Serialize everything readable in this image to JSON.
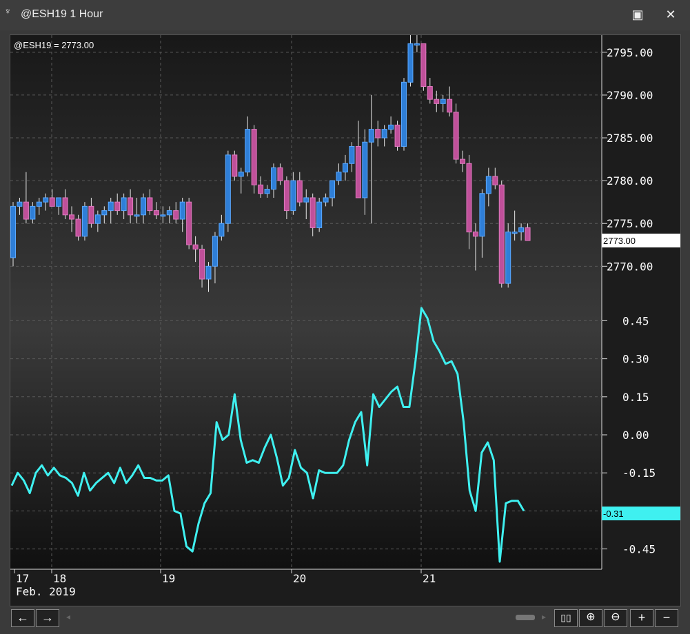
{
  "window": {
    "title": "@ESH19 1 Hour",
    "maximize_icon": "maximize-icon",
    "close_icon": "close-icon"
  },
  "chart_data": [
    {
      "type": "candlestick",
      "title": "@ESH19 = 2773.00",
      "ylim": [
        2766,
        2797
      ],
      "yticks": [
        "2795.00",
        "2790.00",
        "2785.00",
        "2780.00",
        "2775.00",
        "2770.00"
      ],
      "last_price_label": "2773.00",
      "x_labels": [
        "17",
        "18",
        "19",
        "20",
        "21"
      ],
      "x_sublabel": "Feb. 2019",
      "colors": {
        "up": "#2f7fd8",
        "down": "#c0509a",
        "wick": "#e8e8e8"
      },
      "candles": [
        [
          2771.0,
          2777.5,
          2770.0,
          2777.0
        ],
        [
          2777.0,
          2778.0,
          2776.0,
          2777.5
        ],
        [
          2777.5,
          2781.0,
          2775.0,
          2775.5
        ],
        [
          2775.5,
          2777.5,
          2775.0,
          2777.0
        ],
        [
          2777.0,
          2778.0,
          2776.0,
          2777.5
        ],
        [
          2777.5,
          2778.5,
          2776.5,
          2778.0
        ],
        [
          2778.0,
          2779.0,
          2777.0,
          2777.0
        ],
        [
          2777.0,
          2778.0,
          2776.0,
          2778.0
        ],
        [
          2778.0,
          2779.0,
          2775.5,
          2776.0
        ],
        [
          2776.0,
          2777.0,
          2774.0,
          2775.5
        ],
        [
          2775.5,
          2776.0,
          2773.0,
          2773.5
        ],
        [
          2773.5,
          2777.5,
          2773.0,
          2777.0
        ],
        [
          2777.0,
          2778.0,
          2774.5,
          2775.0
        ],
        [
          2775.0,
          2776.5,
          2774.0,
          2776.0
        ],
        [
          2776.0,
          2777.0,
          2775.0,
          2776.5
        ],
        [
          2776.5,
          2778.0,
          2775.0,
          2777.5
        ],
        [
          2777.5,
          2778.5,
          2776.0,
          2776.5
        ],
        [
          2776.5,
          2778.5,
          2775.5,
          2778.0
        ],
        [
          2778.0,
          2779.0,
          2775.0,
          2776.0
        ],
        [
          2776.0,
          2778.0,
          2775.0,
          2776.0
        ],
        [
          2776.0,
          2778.5,
          2775.0,
          2778.0
        ],
        [
          2778.0,
          2779.0,
          2776.0,
          2776.5
        ],
        [
          2776.5,
          2777.5,
          2775.5,
          2776.0
        ],
        [
          2776.0,
          2777.0,
          2775.0,
          2776.0
        ],
        [
          2776.0,
          2777.0,
          2775.0,
          2776.5
        ],
        [
          2776.5,
          2777.5,
          2775.0,
          2775.5
        ],
        [
          2775.5,
          2778.0,
          2774.0,
          2777.5
        ],
        [
          2777.5,
          2778.0,
          2772.0,
          2772.5
        ],
        [
          2772.5,
          2773.5,
          2770.5,
          2772.0
        ],
        [
          2772.0,
          2772.5,
          2767.5,
          2768.5
        ],
        [
          2768.5,
          2770.5,
          2767.0,
          2770.0
        ],
        [
          2770.0,
          2774.0,
          2768.0,
          2773.5
        ],
        [
          2773.5,
          2776.0,
          2773.0,
          2775.0
        ],
        [
          2775.0,
          2783.5,
          2774.0,
          2783.0
        ],
        [
          2783.0,
          2783.5,
          2780.0,
          2780.5
        ],
        [
          2780.5,
          2781.5,
          2778.5,
          2781.0
        ],
        [
          2781.0,
          2787.5,
          2780.5,
          2786.0
        ],
        [
          2786.0,
          2786.5,
          2778.5,
          2779.5
        ],
        [
          2779.5,
          2780.5,
          2778.0,
          2778.5
        ],
        [
          2778.5,
          2779.5,
          2778.0,
          2779.0
        ],
        [
          2779.0,
          2782.0,
          2778.0,
          2781.5
        ],
        [
          2781.5,
          2782.0,
          2779.5,
          2780.0
        ],
        [
          2780.0,
          2780.5,
          2775.5,
          2776.5
        ],
        [
          2776.5,
          2781.0,
          2776.0,
          2780.0
        ],
        [
          2780.0,
          2781.0,
          2777.0,
          2777.5
        ],
        [
          2777.5,
          2779.0,
          2775.5,
          2778.0
        ],
        [
          2778.0,
          2778.5,
          2773.5,
          2774.5
        ],
        [
          2774.5,
          2778.0,
          2774.0,
          2777.5
        ],
        [
          2777.5,
          2778.5,
          2777.0,
          2778.0
        ],
        [
          2778.0,
          2780.0,
          2777.0,
          2780.0
        ],
        [
          2780.0,
          2782.0,
          2779.5,
          2781.0
        ],
        [
          2781.0,
          2783.0,
          2780.0,
          2782.0
        ],
        [
          2782.0,
          2784.5,
          2781.0,
          2784.0
        ],
        [
          2784.0,
          2787.0,
          2778.0,
          2778.0
        ],
        [
          2778.0,
          2786.0,
          2776.0,
          2784.5
        ],
        [
          2784.5,
          2790.0,
          2775.0,
          2786.0
        ],
        [
          2786.0,
          2787.0,
          2784.0,
          2785.0
        ],
        [
          2785.0,
          2786.5,
          2784.0,
          2786.0
        ],
        [
          2786.0,
          2787.5,
          2785.5,
          2786.5
        ],
        [
          2786.5,
          2787.0,
          2783.5,
          2784.0
        ],
        [
          2784.0,
          2792.0,
          2783.5,
          2791.5
        ],
        [
          2791.5,
          2797.5,
          2791.0,
          2796.0
        ],
        [
          2796.0,
          2797.0,
          2795.0,
          2796.0
        ],
        [
          2796.0,
          2796.0,
          2790.5,
          2791.0
        ],
        [
          2791.0,
          2792.0,
          2789.0,
          2789.5
        ],
        [
          2789.5,
          2790.5,
          2788.0,
          2789.0
        ],
        [
          2789.0,
          2790.0,
          2788.0,
          2789.5
        ],
        [
          2789.5,
          2791.0,
          2787.5,
          2788.0
        ],
        [
          2788.0,
          2789.0,
          2782.0,
          2782.5
        ],
        [
          2782.5,
          2783.5,
          2781.0,
          2782.0
        ],
        [
          2782.0,
          2783.0,
          2772.0,
          2774.0
        ],
        [
          2774.0,
          2775.0,
          2769.5,
          2773.5
        ],
        [
          2773.5,
          2779.0,
          2771.0,
          2778.5
        ],
        [
          2778.5,
          2781.5,
          2777.0,
          2780.5
        ],
        [
          2780.5,
          2781.5,
          2779.0,
          2779.5
        ],
        [
          2779.5,
          2780.0,
          2767.5,
          2768.0
        ],
        [
          2768.0,
          2775.0,
          2767.5,
          2774.0
        ],
        [
          2774.0,
          2776.5,
          2773.0,
          2774.0
        ],
        [
          2774.0,
          2775.0,
          2773.0,
          2774.5
        ],
        [
          2774.5,
          2775.0,
          2773.0,
          2773.0
        ]
      ]
    },
    {
      "type": "line",
      "ylim": [
        -0.53,
        0.53
      ],
      "yticks": [
        "0.45",
        "0.30",
        "0.15",
        "0.00",
        "-0.15",
        "-0.30",
        "-0.45"
      ],
      "last_value_label": "-0.31",
      "line_color": "#3ff0f0",
      "values": [
        -0.2,
        -0.15,
        -0.18,
        -0.23,
        -0.15,
        -0.12,
        -0.16,
        -0.13,
        -0.16,
        -0.17,
        -0.19,
        -0.24,
        -0.15,
        -0.22,
        -0.19,
        -0.17,
        -0.15,
        -0.19,
        -0.13,
        -0.19,
        -0.16,
        -0.12,
        -0.17,
        -0.17,
        -0.18,
        -0.18,
        -0.16,
        -0.3,
        -0.31,
        -0.44,
        -0.46,
        -0.35,
        -0.27,
        -0.23,
        0.05,
        -0.02,
        0.0,
        0.16,
        -0.02,
        -0.11,
        -0.1,
        -0.11,
        -0.05,
        0.0,
        -0.09,
        -0.2,
        -0.17,
        -0.06,
        -0.13,
        -0.15,
        -0.25,
        -0.14,
        -0.15,
        -0.15,
        -0.15,
        -0.12,
        -0.02,
        0.05,
        0.09,
        -0.12,
        0.16,
        0.11,
        0.14,
        0.17,
        0.19,
        0.11,
        0.11,
        0.29,
        0.5,
        0.46,
        0.37,
        0.33,
        0.28,
        0.29,
        0.24,
        0.05,
        -0.22,
        -0.3,
        -0.07,
        -0.03,
        -0.1,
        -0.5,
        -0.27,
        -0.26,
        -0.26,
        -0.3
      ]
    }
  ],
  "toolbar": {
    "back_icon": "arrow-left-icon",
    "forward_icon": "arrow-right-icon",
    "bar_spacing_icon": "bar-spacing-icon",
    "zoom_in_icon": "zoom-in-icon",
    "zoom_out_icon": "zoom-out-icon",
    "add_icon": "plus-icon",
    "remove_icon": "minus-icon"
  }
}
